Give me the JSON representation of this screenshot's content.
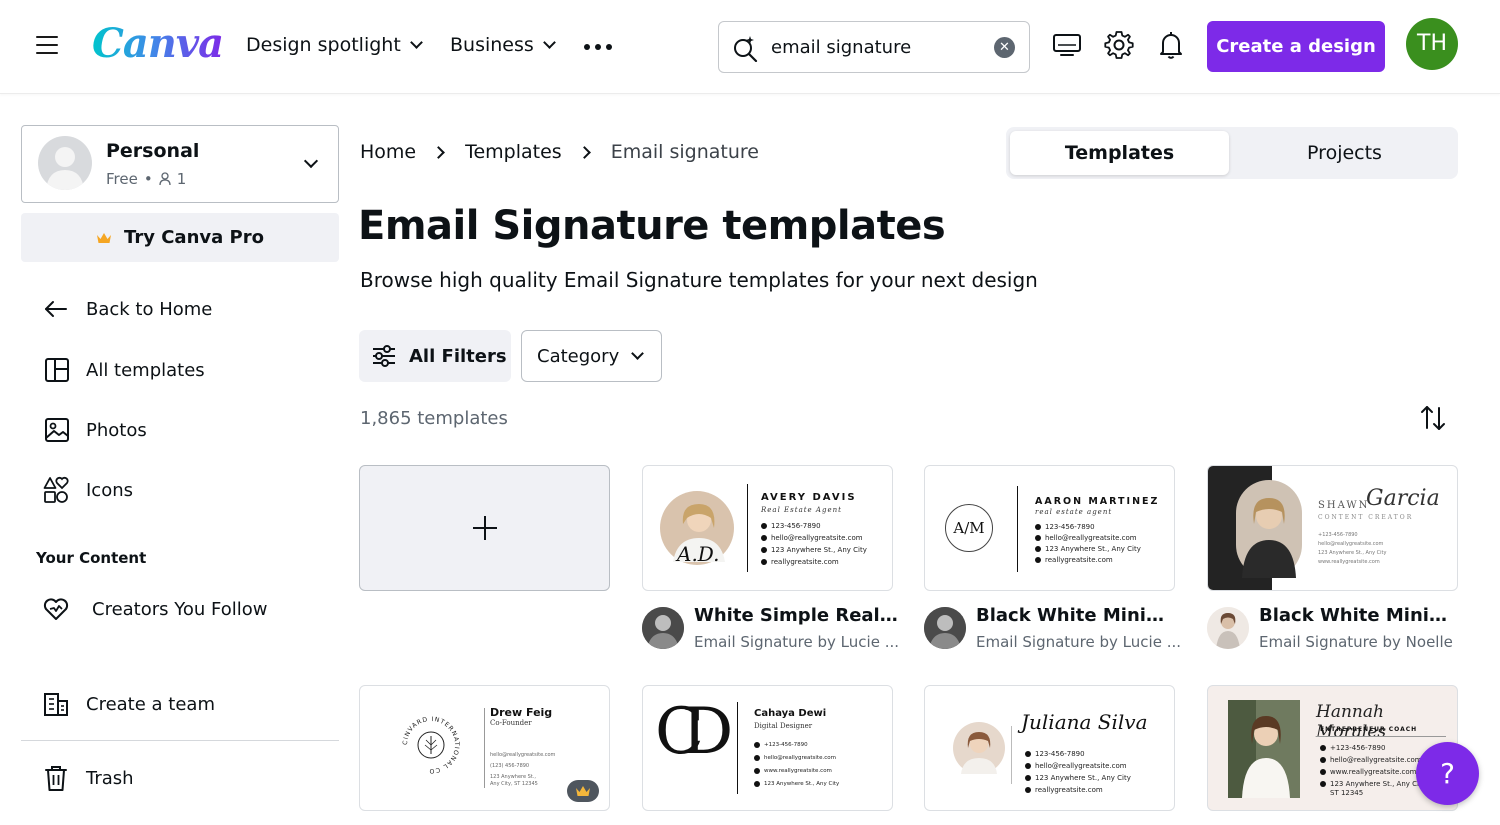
{
  "header": {
    "logo_text": "Canva",
    "nav": [
      {
        "label": "Design spotlight"
      },
      {
        "label": "Business"
      }
    ],
    "search": {
      "value": "email signature",
      "placeholder": "Search"
    },
    "create_button": "Create a design",
    "avatar_initials": "TH"
  },
  "sidebar": {
    "account": {
      "name": "Personal",
      "plan": "Free",
      "members": "1"
    },
    "try_pro": "Try Canva Pro",
    "items": [
      {
        "label": "Back to Home"
      },
      {
        "label": "All templates"
      },
      {
        "label": "Photos"
      },
      {
        "label": "Icons"
      }
    ],
    "your_content_heading": "Your Content",
    "content_items": [
      {
        "label": "Creators You Follow"
      }
    ],
    "bottom_items": [
      {
        "label": "Create a team"
      },
      {
        "label": "Trash"
      }
    ]
  },
  "breadcrumb": [
    "Home",
    "Templates",
    "Email signature"
  ],
  "toggle": {
    "active": "Templates",
    "inactive": "Projects"
  },
  "page": {
    "title": "Email Signature templates",
    "subtitle": "Browse high quality Email Signature templates for your next design"
  },
  "filters": {
    "all_filters": "All Filters",
    "category": "Category"
  },
  "template_count": "1,865 templates",
  "templates_row1": [
    {
      "title": "White Simple Real Es...",
      "subtitle": "Email Signature by Lucie ...",
      "preview": {
        "name": "AVERY DAVIS",
        "role": "Real Estate Agent",
        "lines": [
          "123-456-7890",
          "hello@reallygreatsite.com",
          "123 Anywhere St., Any City",
          "reallygreatsite.com"
        ]
      }
    },
    {
      "title": "Black White Minimal ...",
      "subtitle": "Email Signature by Lucie ...",
      "preview": {
        "monogram": "A/M",
        "name": "AARON MARTINEZ",
        "role": "real estate agent",
        "lines": [
          "123-456-7890",
          "hello@reallygreatsite.com",
          "123 Anywhere St., Any City",
          "reallygreatsite.com"
        ]
      }
    },
    {
      "title": "Black White Minimali...",
      "subtitle": "Email Signature by Noelle",
      "preview": {
        "name": "SHAWN",
        "script": "Garcia",
        "role": "CONTENT CREATOR",
        "lines": [
          "+123-456-7890",
          "hello@reallygreatsite.com",
          "123 Anywhere St., Any City",
          "www.reallygreatsite.com"
        ]
      }
    }
  ],
  "templates_row2": [
    {
      "preview": {
        "seal": "CINVARD INTERNATIONAL CO",
        "name": "Drew Feig",
        "role": "Co-Founder",
        "lines": [
          "hello@reallygreatsite.com",
          "(123) 456-7890",
          "123 Anywhere St.,",
          "Any City, ST 12345"
        ]
      }
    },
    {
      "preview": {
        "monogram": "CD",
        "name": "Cahaya Dewi",
        "role": "Digital Designer",
        "lines": [
          "+123-456-7890",
          "hello@reallygreatsite.com",
          "www.reallygreatsite.com",
          "123 Anywhere St., Any City"
        ]
      }
    },
    {
      "preview": {
        "script": "Juliana Silva",
        "lines": [
          "123-456-7890",
          "hello@reallygreatsite.com",
          "123 Anywhere St., Any City",
          "reallygreatsite.com"
        ]
      }
    },
    {
      "preview": {
        "script": "Hannah Morales",
        "role": "ENTREPRENEUR COACH",
        "lines": [
          "+123-456-7890",
          "hello@reallygreatsite.com",
          "www.reallygreatsite.com",
          "123 Anywhere St., Any City",
          "ST 12345"
        ]
      }
    }
  ],
  "help_button": "?",
  "colors": {
    "brand_purple": "#7d2ae8",
    "avatar_green": "#3a8f1e",
    "panel_grey": "#f0f1f5",
    "text_dark": "#0d1216",
    "text_muted": "#5d6670"
  }
}
